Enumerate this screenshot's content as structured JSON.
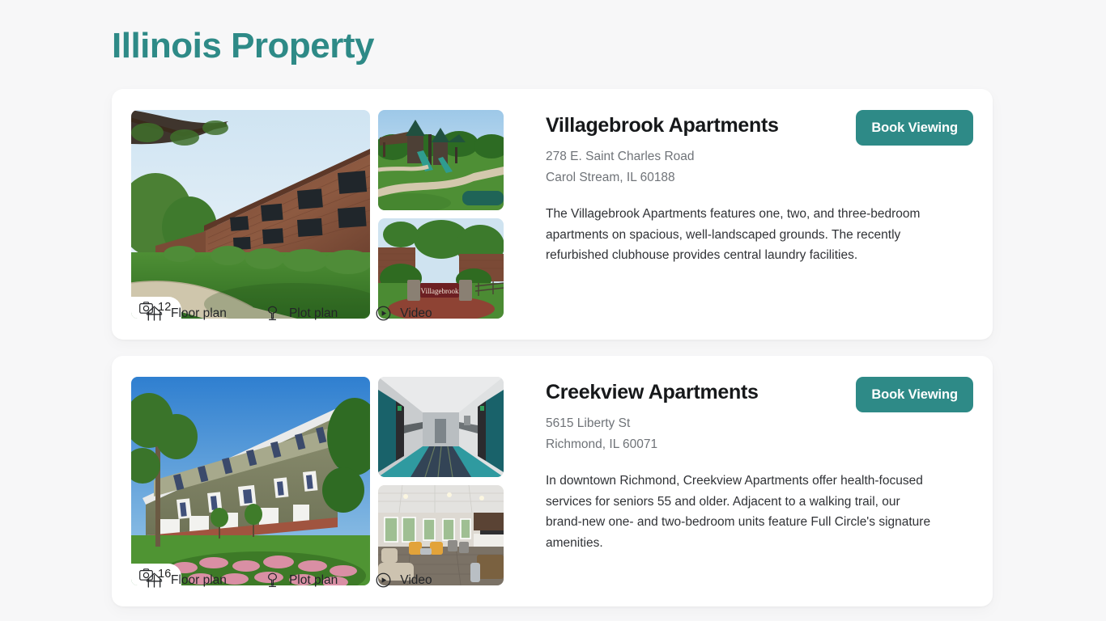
{
  "page": {
    "title": "Illinois Property",
    "background_color": "#f7f7f8",
    "accent_color": "#2e8a87"
  },
  "icons": {
    "camera": "camera-icon",
    "floor_plan": "floor-plan-icon",
    "plot_plan": "tree-icon",
    "video": "play-circle-icon"
  },
  "properties": [
    {
      "name": "Villagebrook Apartments",
      "address_line1": "278 E. Saint Charles Road",
      "address_line2": "Carol Stream, IL 60188",
      "description": "The Villagebrook Apartments features one, two, and three-bedroom apartments on spacious, well-landscaped grounds. The recently refurbished clubhouse provides central laundry facilities.",
      "photo_count": "12",
      "book_label": "Book Viewing",
      "actions": [
        {
          "label": "Floor plan",
          "icon": "floor-plan-icon"
        },
        {
          "label": "Plot plan",
          "icon": "tree-icon"
        },
        {
          "label": "Video",
          "icon": "play-circle-icon"
        }
      ],
      "images": {
        "main_alt": "Brick apartment building exterior with lawn and walking path",
        "thumb1_alt": "Playground with towers on green lawn",
        "thumb2_alt": "Villagebrook entrance sign with stone pillars"
      }
    },
    {
      "name": "Creekview Apartments",
      "address_line1": "5615 Liberty St",
      "address_line2": "Richmond, IL 60071",
      "description": "In downtown Richmond, Creekview Apartments offer health-focused services for seniors 55 and older. Adjacent to a walking trail, our brand-new one- and two-bedroom units feature Full Circle's signature amenities.",
      "photo_count": "16",
      "book_label": "Book Viewing",
      "actions": [
        {
          "label": "Floor plan",
          "icon": "floor-plan-icon"
        },
        {
          "label": "Plot plan",
          "icon": "tree-icon"
        },
        {
          "label": "Video",
          "icon": "play-circle-icon"
        }
      ],
      "images": {
        "main_alt": "Olive green sided apartment building with trees and pink flowers",
        "thumb1_alt": "Interior corridor with teal doors and patterned carpet",
        "thumb2_alt": "Community lounge with sofas, armchairs and kitchen"
      }
    }
  ]
}
